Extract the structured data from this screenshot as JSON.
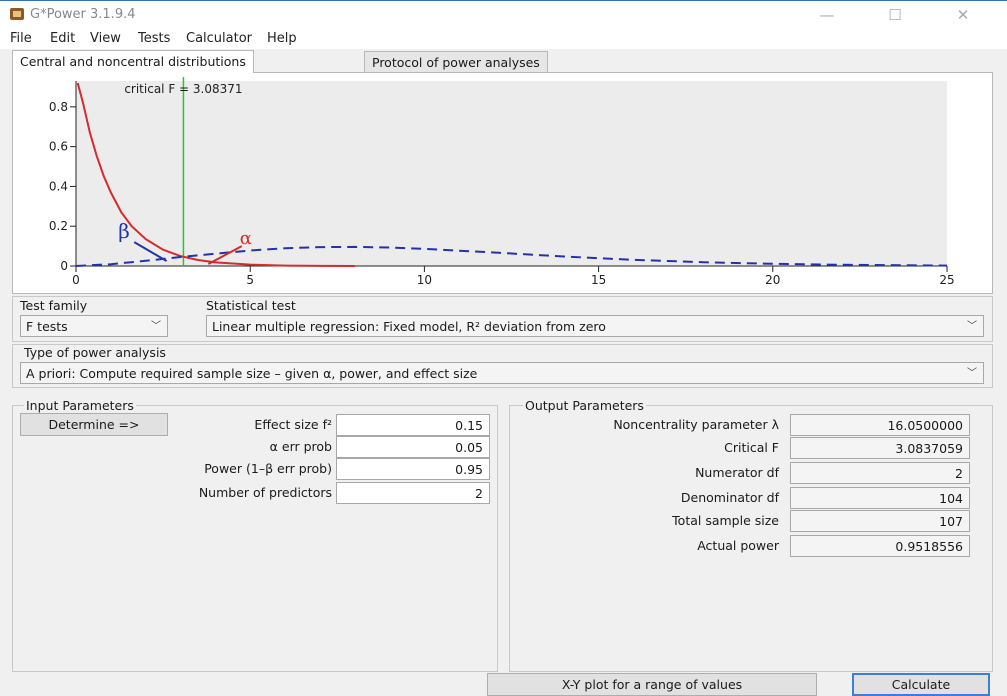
{
  "window": {
    "title": "G*Power 3.1.9.4",
    "minimize": "—",
    "maximize": "☐",
    "close": "✕"
  },
  "menu": [
    "File",
    "Edit",
    "View",
    "Tests",
    "Calculator",
    "Help"
  ],
  "tabs": [
    "Central and noncentral distributions",
    "Protocol of power analyses"
  ],
  "chart_data": {
    "type": "line",
    "annotation": "critical F = 3.08371",
    "critical_f": 3.08371,
    "x_ticks": [
      0,
      5,
      10,
      15,
      20,
      25
    ],
    "y_ticks": [
      0,
      0.2,
      0.4,
      0.6,
      0.8
    ],
    "xlim": [
      0,
      25
    ],
    "ylim": [
      0,
      0.93
    ],
    "series": [
      {
        "name": "",
        "style": "solid",
        "color": "#d42b2b",
        "x": [
          0.05,
          0.2,
          0.4,
          0.6,
          0.8,
          1.0,
          1.3,
          1.6,
          2.0,
          2.5,
          3.0,
          3.5,
          4.0,
          5,
          6,
          7,
          8
        ],
        "y": [
          0.92,
          0.82,
          0.67,
          0.55,
          0.45,
          0.37,
          0.27,
          0.2,
          0.135,
          0.082,
          0.05,
          0.03,
          0.018,
          0.007,
          0.002,
          0.0006,
          0.0002
        ]
      },
      {
        "name": "",
        "style": "dashed",
        "color": "#2233aa",
        "x": [
          0,
          1,
          2,
          3,
          4,
          5,
          6,
          7,
          8,
          9,
          10,
          12,
          14,
          16,
          18,
          20,
          22,
          25
        ],
        "y": [
          0.0,
          0.009,
          0.026,
          0.045,
          0.062,
          0.078,
          0.089,
          0.095,
          0.096,
          0.093,
          0.086,
          0.068,
          0.048,
          0.031,
          0.019,
          0.011,
          0.006,
          0.002
        ]
      }
    ],
    "labels": {
      "beta": "β",
      "alpha": "α"
    },
    "colors": {
      "central": "#d42b2b",
      "noncentral": "#2233aa",
      "critical": "#22cc22"
    }
  },
  "test_family": {
    "label": "Test family",
    "value": "F tests"
  },
  "statistical_test": {
    "label": "Statistical test",
    "value": "Linear multiple regression: Fixed model, R² deviation from zero"
  },
  "power_analysis": {
    "label": "Type of power analysis",
    "value": "A priori: Compute required sample size – given α, power, and effect size"
  },
  "input": {
    "title": "Input Parameters",
    "determine": "Determine =>",
    "rows": [
      {
        "label": "Effect size f²",
        "value": "0.15"
      },
      {
        "label": "α err prob",
        "value": "0.05"
      },
      {
        "label": "Power (1–β err prob)",
        "value": "0.95"
      },
      {
        "label": "Number of predictors",
        "value": "2"
      }
    ]
  },
  "output": {
    "title": "Output Parameters",
    "rows": [
      {
        "label": "Noncentrality parameter λ",
        "value": "16.0500000"
      },
      {
        "label": "Critical F",
        "value": "3.0837059"
      },
      {
        "label": "Numerator df",
        "value": "2"
      },
      {
        "label": "Denominator df",
        "value": "104"
      },
      {
        "label": "Total sample size",
        "value": "107"
      },
      {
        "label": "Actual power",
        "value": "0.9518556"
      }
    ]
  },
  "buttons": {
    "xy_plot": "X-Y plot for a range of values",
    "calculate": "Calculate"
  }
}
